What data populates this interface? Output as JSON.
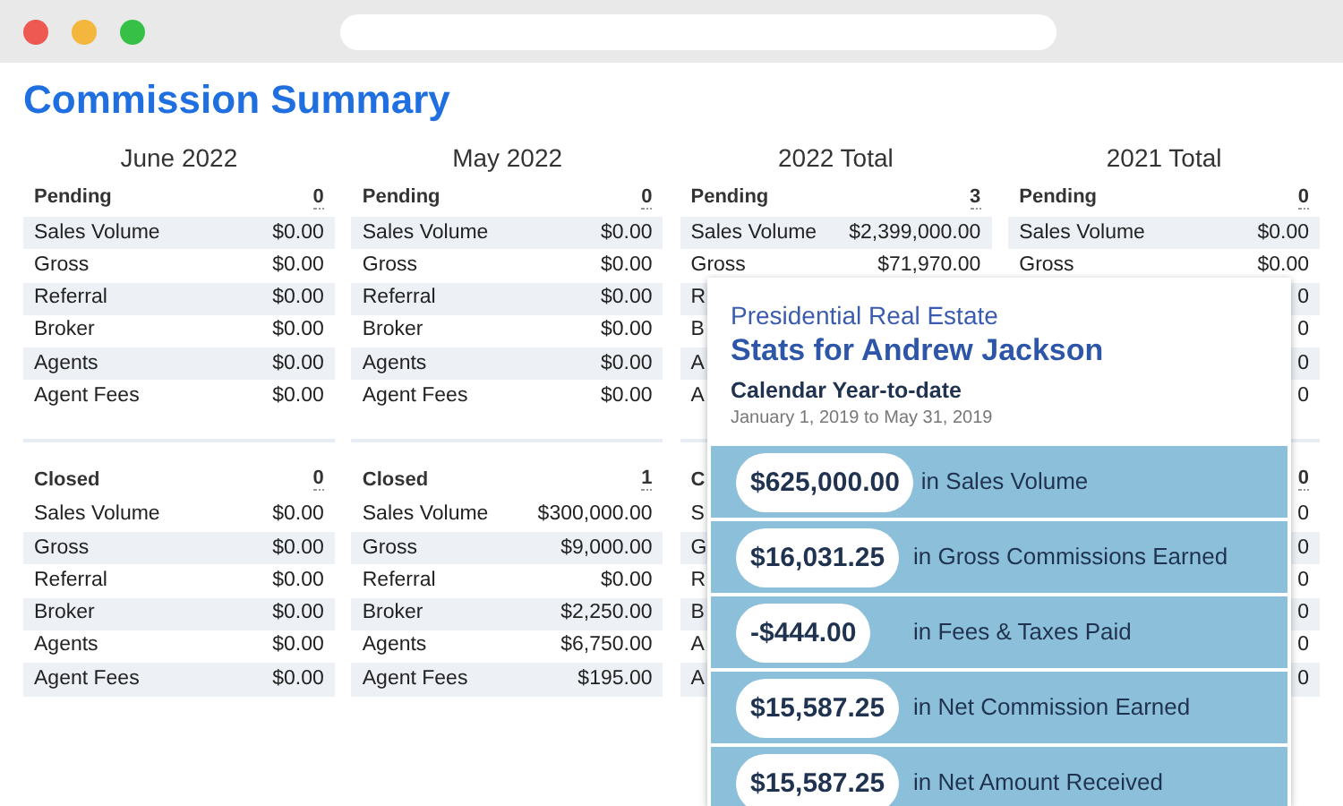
{
  "title": "Commission Summary",
  "columns": [
    {
      "title": "June 2022",
      "sections": [
        {
          "label": "Pending",
          "count": "0",
          "rows": [
            {
              "label": "Sales Volume",
              "value": "$0.00"
            },
            {
              "label": "Gross",
              "value": "$0.00"
            },
            {
              "label": "Referral",
              "value": "$0.00"
            },
            {
              "label": "Broker",
              "value": "$0.00"
            },
            {
              "label": "Agents",
              "value": "$0.00"
            },
            {
              "label": "Agent Fees",
              "value": "$0.00"
            }
          ]
        },
        {
          "label": "Closed",
          "count": "0",
          "rows": [
            {
              "label": "Sales Volume",
              "value": "$0.00"
            },
            {
              "label": "Gross",
              "value": "$0.00"
            },
            {
              "label": "Referral",
              "value": "$0.00"
            },
            {
              "label": "Broker",
              "value": "$0.00"
            },
            {
              "label": "Agents",
              "value": "$0.00"
            },
            {
              "label": "Agent Fees",
              "value": "$0.00"
            }
          ]
        }
      ]
    },
    {
      "title": "May 2022",
      "sections": [
        {
          "label": "Pending",
          "count": "0",
          "rows": [
            {
              "label": "Sales Volume",
              "value": "$0.00"
            },
            {
              "label": "Gross",
              "value": "$0.00"
            },
            {
              "label": "Referral",
              "value": "$0.00"
            },
            {
              "label": "Broker",
              "value": "$0.00"
            },
            {
              "label": "Agents",
              "value": "$0.00"
            },
            {
              "label": "Agent Fees",
              "value": "$0.00"
            }
          ]
        },
        {
          "label": "Closed",
          "count": "1",
          "rows": [
            {
              "label": "Sales Volume",
              "value": "$300,000.00"
            },
            {
              "label": "Gross",
              "value": "$9,000.00"
            },
            {
              "label": "Referral",
              "value": "$0.00"
            },
            {
              "label": "Broker",
              "value": "$2,250.00"
            },
            {
              "label": "Agents",
              "value": "$6,750.00"
            },
            {
              "label": "Agent Fees",
              "value": "$195.00"
            }
          ]
        }
      ]
    },
    {
      "title": "2022 Total",
      "sections": [
        {
          "label": "Pending",
          "count": "3",
          "rows": [
            {
              "label": "Sales Volume",
              "value": "$2,399,000.00"
            },
            {
              "label": "Gross",
              "value": "$71,970.00"
            },
            {
              "label": "R"
            },
            {
              "label": "B"
            },
            {
              "label": "A"
            },
            {
              "label": "A"
            }
          ]
        },
        {
          "label": "C",
          "rows": [
            {
              "label": "S"
            },
            {
              "label": "G"
            },
            {
              "label": "R"
            },
            {
              "label": "B"
            },
            {
              "label": "A"
            },
            {
              "label": "A"
            }
          ]
        }
      ]
    },
    {
      "title": "2021 Total",
      "sections": [
        {
          "label": "Pending",
          "count": "0",
          "rows": [
            {
              "label": "Sales Volume",
              "value": "$0.00"
            },
            {
              "label": "Gross",
              "value": "$0.00"
            },
            {
              "value": "0"
            },
            {
              "value": "0"
            },
            {
              "value": "0"
            },
            {
              "value": "0"
            }
          ]
        },
        {
          "count": "0",
          "rows": [
            {
              "value": "0"
            },
            {
              "value": "0"
            },
            {
              "value": "0"
            },
            {
              "value": "0"
            },
            {
              "value": "0"
            },
            {
              "value": "0"
            }
          ]
        }
      ]
    }
  ],
  "stats_popup": {
    "company": "Presidential Real Estate",
    "heading": "Stats for Andrew Jackson",
    "period": "Calendar Year-to-date",
    "date_range": "January 1, 2019 to May 31, 2019",
    "stats": [
      {
        "amount": "$625,000.00",
        "label": "in Sales Volume"
      },
      {
        "amount": "$16,031.25",
        "label": "in Gross Commissions Earned"
      },
      {
        "amount": "-$444.00",
        "label": "in Fees & Taxes Paid"
      },
      {
        "amount": "$15,587.25",
        "label": "in Net Commission Earned"
      },
      {
        "amount": "$15,587.25",
        "label": "in Net Amount Received"
      }
    ]
  }
}
